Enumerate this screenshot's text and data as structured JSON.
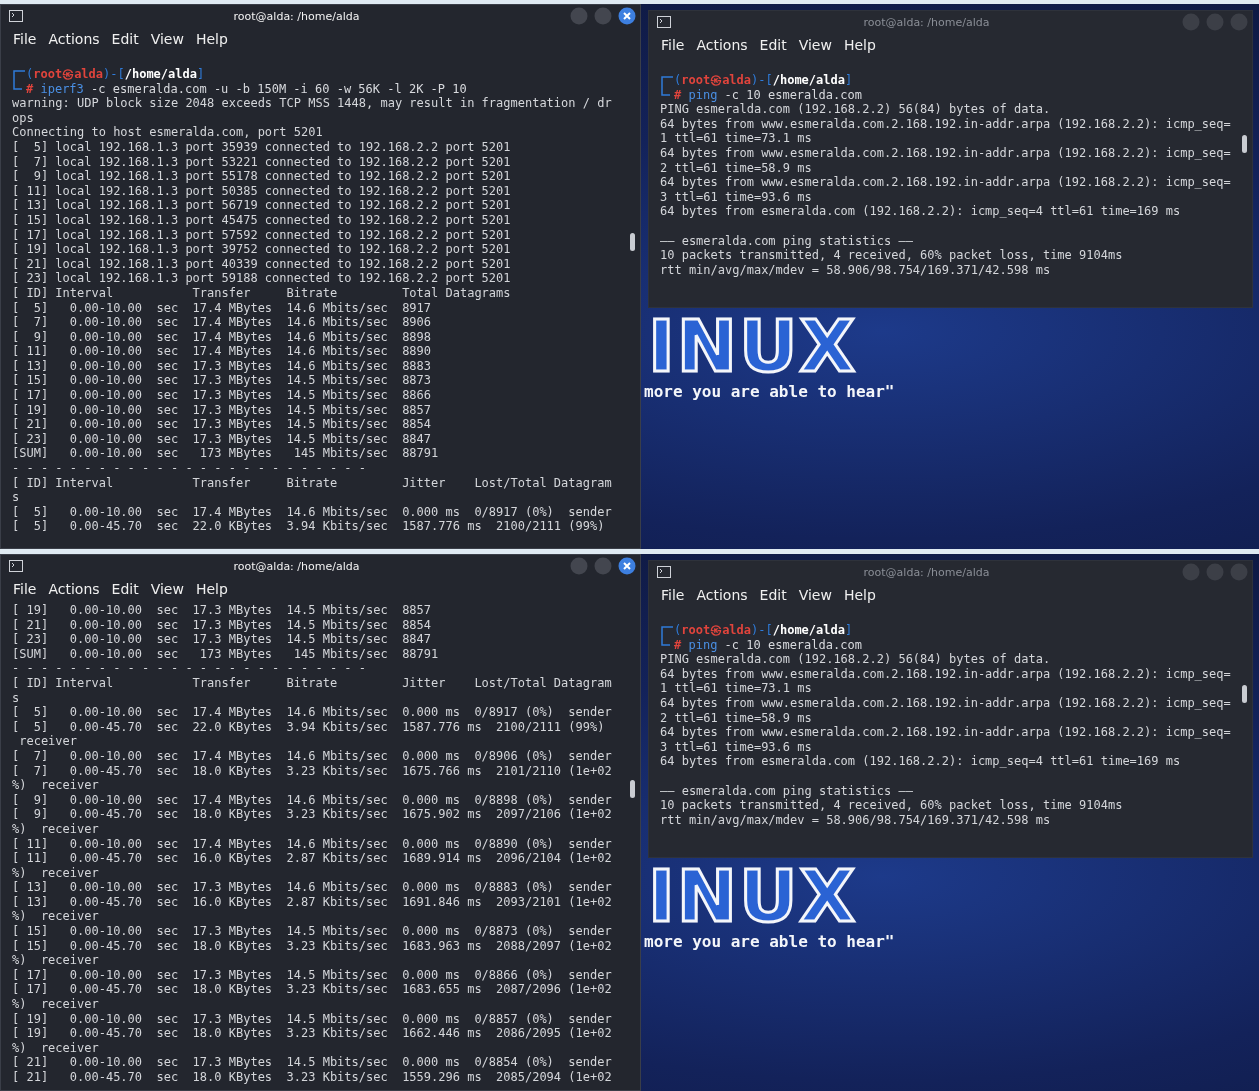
{
  "screens": [
    {
      "terminals": [
        {
          "title": "root@alda: /home/alda",
          "active": true,
          "menu": [
            "File",
            "Actions",
            "Edit",
            "View",
            "Help"
          ],
          "prompt": {
            "parts": [
              {
                "kind": "punct",
                "text": "("
              },
              {
                "kind": "user",
                "text": "root㉿alda"
              },
              {
                "kind": "punct",
                "text": ")-["
              },
              {
                "kind": "path",
                "text": "/home/alda"
              },
              {
                "kind": "punct",
                "text": "]"
              }
            ],
            "symbol": "#",
            "command": "iperf3",
            "args": "-c esmeralda.com -u -b 150M -i 60 -w 56K -l 2K -P 10"
          },
          "blocks": [
            [
              "warning: UDP block size 2048 exceeds TCP MSS 1448, may result in fragmentation / dr",
              "ops",
              "Connecting to host esmeralda.com, port 5201",
              "[  5] local 192.168.1.3 port 35939 connected to 192.168.2.2 port 5201",
              "[  7] local 192.168.1.3 port 53221 connected to 192.168.2.2 port 5201",
              "[  9] local 192.168.1.3 port 55178 connected to 192.168.2.2 port 5201",
              "[ 11] local 192.168.1.3 port 50385 connected to 192.168.2.2 port 5201",
              "[ 13] local 192.168.1.3 port 56719 connected to 192.168.2.2 port 5201",
              "[ 15] local 192.168.1.3 port 45475 connected to 192.168.2.2 port 5201",
              "[ 17] local 192.168.1.3 port 57592 connected to 192.168.2.2 port 5201",
              "[ 19] local 192.168.1.3 port 39752 connected to 192.168.2.2 port 5201",
              "[ 21] local 192.168.1.3 port 40339 connected to 192.168.2.2 port 5201",
              "[ 23] local 192.168.1.3 port 59188 connected to 192.168.2.2 port 5201",
              "[ ID] Interval           Transfer     Bitrate         Total Datagrams",
              "[  5]   0.00-10.00  sec  17.4 MBytes  14.6 Mbits/sec  8917",
              "[  7]   0.00-10.00  sec  17.4 MBytes  14.6 Mbits/sec  8906",
              "[  9]   0.00-10.00  sec  17.4 MBytes  14.6 Mbits/sec  8898",
              "[ 11]   0.00-10.00  sec  17.4 MBytes  14.6 Mbits/sec  8890",
              "[ 13]   0.00-10.00  sec  17.3 MBytes  14.6 Mbits/sec  8883",
              "[ 15]   0.00-10.00  sec  17.3 MBytes  14.5 Mbits/sec  8873",
              "[ 17]   0.00-10.00  sec  17.3 MBytes  14.5 Mbits/sec  8866",
              "[ 19]   0.00-10.00  sec  17.3 MBytes  14.5 Mbits/sec  8857",
              "[ 21]   0.00-10.00  sec  17.3 MBytes  14.5 Mbits/sec  8854",
              "[ 23]   0.00-10.00  sec  17.3 MBytes  14.5 Mbits/sec  8847",
              "[SUM]   0.00-10.00  sec   173 MBytes   145 Mbits/sec  88791",
              "- - - - - - - - - - - - - - - - - - - - - - - - -",
              "[ ID] Interval           Transfer     Bitrate         Jitter    Lost/Total Datagram",
              "s",
              "[  5]   0.00-10.00  sec  17.4 MBytes  14.6 Mbits/sec  0.000 ms  0/8917 (0%)  sender",
              "[  5]   0.00-45.70  sec  22.0 KBytes  3.94 Kbits/sec  1587.776 ms  2100/2111 (99%)"
            ]
          ]
        },
        {
          "title": "root@alda: /home/alda",
          "active": false,
          "menu": [
            "File",
            "Actions",
            "Edit",
            "View",
            "Help"
          ],
          "prompt": {
            "parts": [
              {
                "kind": "punct",
                "text": "("
              },
              {
                "kind": "user",
                "text": "root㉿alda"
              },
              {
                "kind": "punct",
                "text": ")-["
              },
              {
                "kind": "path",
                "text": "/home/alda"
              },
              {
                "kind": "punct",
                "text": "]"
              }
            ],
            "symbol": "#",
            "command": "ping",
            "args": "-c 10 esmeralda.com"
          },
          "blocks": [
            [
              "PING esmeralda.com (192.168.2.2) 56(84) bytes of data.",
              "64 bytes from www.esmeralda.com.2.168.192.in-addr.arpa (192.168.2.2): icmp_seq=",
              "1 ttl=61 time=73.1 ms",
              "64 bytes from www.esmeralda.com.2.168.192.in-addr.arpa (192.168.2.2): icmp_seq=",
              "2 ttl=61 time=58.9 ms",
              "64 bytes from www.esmeralda.com.2.168.192.in-addr.arpa (192.168.2.2): icmp_seq=",
              "3 ttl=61 time=93.6 ms",
              "64 bytes from esmeralda.com (192.168.2.2): icmp_seq=4 ttl=61 time=169 ms"
            ],
            [
              "—— esmeralda.com ping statistics ——",
              "10 packets transmitted, 4 received, 60% packet loss, time 9104ms",
              "rtt min/avg/max/mdev = 58.906/98.754/169.371/42.598 ms"
            ]
          ]
        }
      ],
      "wallpaper": {
        "logo": "INUX",
        "tagline": "more you are able to hear\""
      }
    },
    {
      "terminals": [
        {
          "title": "root@alda: /home/alda",
          "active": true,
          "menu": [
            "File",
            "Actions",
            "Edit",
            "View",
            "Help"
          ],
          "blocks": [
            [
              "[ 19]   0.00-10.00  sec  17.3 MBytes  14.5 Mbits/sec  8857",
              "[ 21]   0.00-10.00  sec  17.3 MBytes  14.5 Mbits/sec  8854",
              "[ 23]   0.00-10.00  sec  17.3 MBytes  14.5 Mbits/sec  8847",
              "[SUM]   0.00-10.00  sec   173 MBytes   145 Mbits/sec  88791",
              "- - - - - - - - - - - - - - - - - - - - - - - - -",
              "[ ID] Interval           Transfer     Bitrate         Jitter    Lost/Total Datagram",
              "s",
              "[  5]   0.00-10.00  sec  17.4 MBytes  14.6 Mbits/sec  0.000 ms  0/8917 (0%)  sender",
              "[  5]   0.00-45.70  sec  22.0 KBytes  3.94 Kbits/sec  1587.776 ms  2100/2111 (99%)",
              " receiver",
              "[  7]   0.00-10.00  sec  17.4 MBytes  14.6 Mbits/sec  0.000 ms  0/8906 (0%)  sender",
              "[  7]   0.00-45.70  sec  18.0 KBytes  3.23 Kbits/sec  1675.766 ms  2101/2110 (1e+02",
              "%)  receiver",
              "[  9]   0.00-10.00  sec  17.4 MBytes  14.6 Mbits/sec  0.000 ms  0/8898 (0%)  sender",
              "[  9]   0.00-45.70  sec  18.0 KBytes  3.23 Kbits/sec  1675.902 ms  2097/2106 (1e+02",
              "%)  receiver",
              "[ 11]   0.00-10.00  sec  17.4 MBytes  14.6 Mbits/sec  0.000 ms  0/8890 (0%)  sender",
              "[ 11]   0.00-45.70  sec  16.0 KBytes  2.87 Kbits/sec  1689.914 ms  2096/2104 (1e+02",
              "%)  receiver",
              "[ 13]   0.00-10.00  sec  17.3 MBytes  14.6 Mbits/sec  0.000 ms  0/8883 (0%)  sender",
              "[ 13]   0.00-45.70  sec  16.0 KBytes  2.87 Kbits/sec  1691.846 ms  2093/2101 (1e+02",
              "%)  receiver",
              "[ 15]   0.00-10.00  sec  17.3 MBytes  14.5 Mbits/sec  0.000 ms  0/8873 (0%)  sender",
              "[ 15]   0.00-45.70  sec  18.0 KBytes  3.23 Kbits/sec  1683.963 ms  2088/2097 (1e+02",
              "%)  receiver",
              "[ 17]   0.00-10.00  sec  17.3 MBytes  14.5 Mbits/sec  0.000 ms  0/8866 (0%)  sender",
              "[ 17]   0.00-45.70  sec  18.0 KBytes  3.23 Kbits/sec  1683.655 ms  2087/2096 (1e+02",
              "%)  receiver",
              "[ 19]   0.00-10.00  sec  17.3 MBytes  14.5 Mbits/sec  0.000 ms  0/8857 (0%)  sender",
              "[ 19]   0.00-45.70  sec  18.0 KBytes  3.23 Kbits/sec  1662.446 ms  2086/2095 (1e+02",
              "%)  receiver",
              "[ 21]   0.00-10.00  sec  17.3 MBytes  14.5 Mbits/sec  0.000 ms  0/8854 (0%)  sender",
              "[ 21]   0.00-45.70  sec  18.0 KBytes  3.23 Kbits/sec  1559.296 ms  2085/2094 (1e+02"
            ]
          ]
        },
        {
          "title": "root@alda: /home/alda",
          "active": false,
          "menu": [
            "File",
            "Actions",
            "Edit",
            "View",
            "Help"
          ],
          "prompt": {
            "parts": [
              {
                "kind": "punct",
                "text": "("
              },
              {
                "kind": "user",
                "text": "root㉿alda"
              },
              {
                "kind": "punct",
                "text": ")-["
              },
              {
                "kind": "path",
                "text": "/home/alda"
              },
              {
                "kind": "punct",
                "text": "]"
              }
            ],
            "symbol": "#",
            "command": "ping",
            "args": "-c 10 esmeralda.com"
          },
          "blocks": [
            [
              "PING esmeralda.com (192.168.2.2) 56(84) bytes of data.",
              "64 bytes from www.esmeralda.com.2.168.192.in-addr.arpa (192.168.2.2): icmp_seq=",
              "1 ttl=61 time=73.1 ms",
              "64 bytes from www.esmeralda.com.2.168.192.in-addr.arpa (192.168.2.2): icmp_seq=",
              "2 ttl=61 time=58.9 ms",
              "64 bytes from www.esmeralda.com.2.168.192.in-addr.arpa (192.168.2.2): icmp_seq=",
              "3 ttl=61 time=93.6 ms",
              "64 bytes from esmeralda.com (192.168.2.2): icmp_seq=4 ttl=61 time=169 ms"
            ],
            [
              "—— esmeralda.com ping statistics ——",
              "10 packets transmitted, 4 received, 60% packet loss, time 9104ms",
              "rtt min/avg/max/mdev = 58.906/98.754/169.371/42.598 ms"
            ]
          ]
        }
      ],
      "wallpaper": {
        "logo": "INUX",
        "tagline": "more you are able to hear\""
      }
    }
  ]
}
